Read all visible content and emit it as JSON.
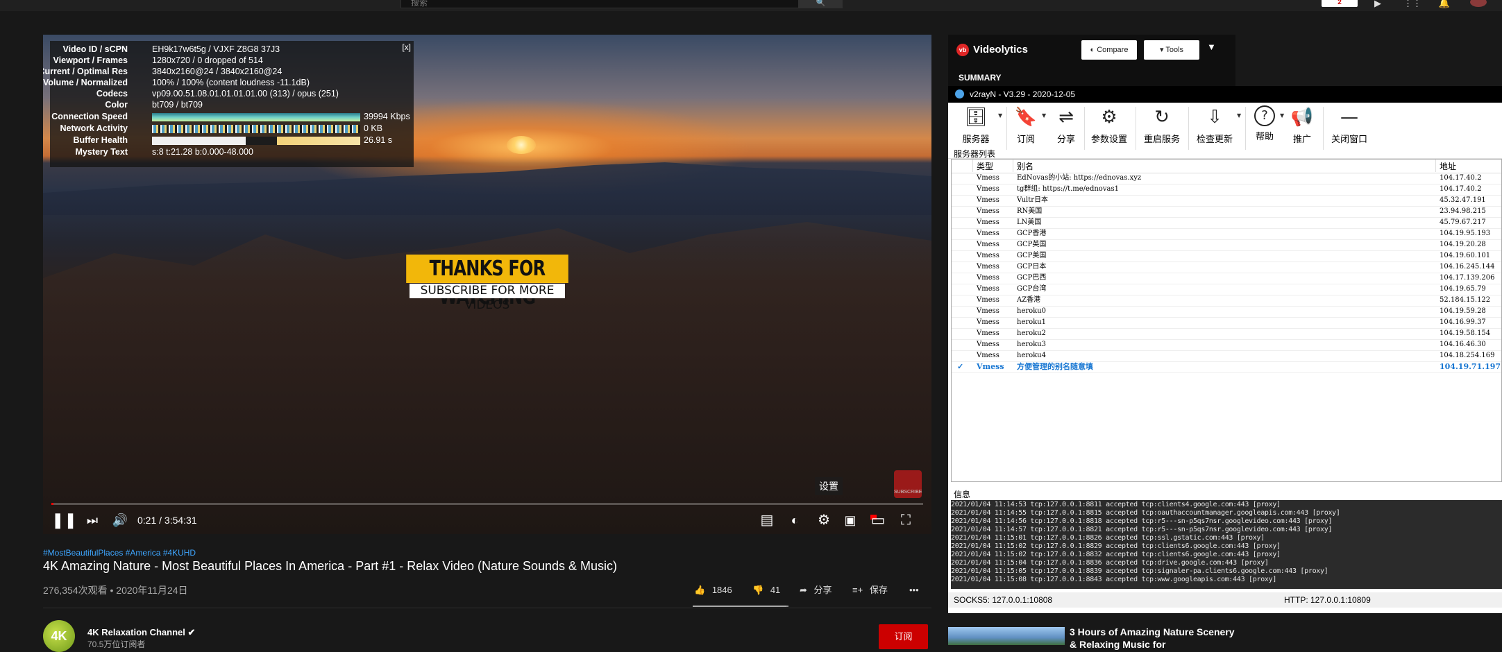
{
  "youtube": {
    "search_placeholder": "搜索",
    "search_icon_glyph": "🔍",
    "topbar_badge": "2",
    "topbar_icons": [
      "video-camera",
      "apps-grid",
      "bell"
    ]
  },
  "player": {
    "stats": [
      {
        "label": "Video ID / sCPN",
        "value": "EH9k17w6t5g / VJXF Z8G8 37J3"
      },
      {
        "label": "Viewport / Frames",
        "value": "1280x720 / 0 dropped of 514"
      },
      {
        "label": "Current / Optimal Res",
        "value": "3840x2160@24 / 3840x2160@24"
      },
      {
        "label": "Volume / Normalized",
        "value": "100% / 100% (content loudness -11.1dB)"
      },
      {
        "label": "Codecs",
        "value": "vp09.00.51.08.01.01.01.01.00 (313) / opus (251)"
      },
      {
        "label": "Color",
        "value": "bt709 / bt709"
      },
      {
        "label": "Connection Speed",
        "value": "39994 Kbps"
      },
      {
        "label": "Network Activity",
        "value": "0 KB"
      },
      {
        "label": "Buffer Health",
        "value": "26.91 s"
      },
      {
        "label": "Mystery Text",
        "value": "s:8 t:21.28 b:0.000-48.000"
      }
    ],
    "stats_close": "[x]",
    "overlay_title": "THANKS FOR WATCHING",
    "overlay_subtitle": "SUBSCRIBE FOR MORE VIDEOS",
    "time_display": "0:21 / 3:54:31",
    "progress_fraction": 0.0015,
    "settings_tooltip": "设置",
    "watermark_text": "SUBSCRIBE",
    "controls": {
      "play_pause": "❚❚",
      "next": "⏭",
      "volume": "🔊",
      "subtitles": "▤",
      "autoplay": "◐",
      "settings": "⚙",
      "miniplayer": "▣",
      "theater": "▭",
      "fullscreen": "⛶"
    }
  },
  "video": {
    "hashtags": "#MostBeautifulPlaces #America #4KUHD",
    "title": "4K Amazing Nature - Most Beautiful Places In America - Part #1 - Relax Video (Nature Sounds & Music)",
    "views": "276,354次观看 • 2020年11月24日",
    "likes": "1846",
    "dislikes": "41",
    "like_ratio": 0.978,
    "share": "分享",
    "save": "保存",
    "more": "•••",
    "like_icon": "👍",
    "dislike_icon": "👎",
    "share_icon": "➦",
    "save_icon": "≡+"
  },
  "channel": {
    "avatar_text": "4K",
    "name": "4K Relaxation Channel ✔",
    "subscribers": "70.5万位订阅者",
    "subscribe_button": "订阅"
  },
  "videolytics": {
    "logo": "vb",
    "title": "Videolytics",
    "compare": "◐ Compare",
    "tools": "▾ Tools",
    "caret": "▼",
    "summary": "SUMMARY"
  },
  "v2rayn": {
    "title": "v2rayN - V3.29 - 2020-12-05",
    "toolbar": [
      {
        "label": "服务器",
        "icon": "database-icon",
        "glyph": "🗄"
      },
      {
        "label": "订阅",
        "icon": "bookmark-icon",
        "glyph": "🔖"
      },
      {
        "label": "分享",
        "icon": "share-icon",
        "glyph": "⇌"
      },
      {
        "label": "参数设置",
        "icon": "gear-icon",
        "glyph": "⚙"
      },
      {
        "label": "重启服务",
        "icon": "refresh-icon",
        "glyph": "↻"
      },
      {
        "label": "检查更新",
        "icon": "download-icon",
        "glyph": "⇩"
      },
      {
        "label": "帮助",
        "icon": "help-icon",
        "glyph": "?"
      },
      {
        "label": "推广",
        "icon": "megaphone-icon",
        "glyph": "📢"
      },
      {
        "label": "关闭窗口",
        "icon": "minimize-icon",
        "glyph": "—"
      }
    ],
    "server_list_label": "服务器列表",
    "columns": {
      "type": "类型",
      "alias": "别名",
      "address": "地址"
    },
    "servers": [
      {
        "type": "Vmess",
        "alias": "EdNovas的小站: https://ednovas.xyz",
        "address": "104.17.40.2"
      },
      {
        "type": "Vmess",
        "alias": "tg群组: https://t.me/ednovas1",
        "address": "104.17.40.2"
      },
      {
        "type": "Vmess",
        "alias": "Vultr日本",
        "address": "45.32.47.191"
      },
      {
        "type": "Vmess",
        "alias": "RN美国",
        "address": "23.94.98.215"
      },
      {
        "type": "Vmess",
        "alias": "LN美国",
        "address": "45.79.67.217"
      },
      {
        "type": "Vmess",
        "alias": "GCP香港",
        "address": "104.19.95.193"
      },
      {
        "type": "Vmess",
        "alias": "GCP英国",
        "address": "104.19.20.28"
      },
      {
        "type": "Vmess",
        "alias": "GCP美国",
        "address": "104.19.60.101"
      },
      {
        "type": "Vmess",
        "alias": "GCP日本",
        "address": "104.16.245.144"
      },
      {
        "type": "Vmess",
        "alias": "GCP巴西",
        "address": "104.17.139.206"
      },
      {
        "type": "Vmess",
        "alias": "GCP台湾",
        "address": "104.19.65.79"
      },
      {
        "type": "Vmess",
        "alias": "AZ香港",
        "address": "52.184.15.122"
      },
      {
        "type": "Vmess",
        "alias": "heroku0",
        "address": "104.19.59.28"
      },
      {
        "type": "Vmess",
        "alias": "heroku1",
        "address": "104.16.99.37"
      },
      {
        "type": "Vmess",
        "alias": "heroku2",
        "address": "104.19.58.154"
      },
      {
        "type": "Vmess",
        "alias": "heroku3",
        "address": "104.16.46.30"
      },
      {
        "type": "Vmess",
        "alias": "heroku4",
        "address": "104.18.254.169"
      },
      {
        "type": "Vmess",
        "alias": "方便管理的别名随意填",
        "address": "104.19.71.197",
        "selected": true,
        "check": "✓"
      }
    ],
    "info_label": "信息",
    "log": [
      "2021/01/04 11:14:53 tcp:127.0.0.1:8811 accepted tcp:clients4.google.com:443 [proxy]",
      "2021/01/04 11:14:55 tcp:127.0.0.1:8815 accepted tcp:oauthaccountmanager.googleapis.com:443 [proxy]",
      "2021/01/04 11:14:56 tcp:127.0.0.1:8818 accepted tcp:r5---sn-p5qs7nsr.googlevideo.com:443 [proxy]",
      "2021/01/04 11:14:57 tcp:127.0.0.1:8821 accepted tcp:r5---sn-p5qs7nsr.googlevideo.com:443 [proxy]",
      "2021/01/04 11:15:01 tcp:127.0.0.1:8826 accepted tcp:ssl.gstatic.com:443 [proxy]",
      "2021/01/04 11:15:02 tcp:127.0.0.1:8829 accepted tcp:clients6.google.com:443 [proxy]",
      "2021/01/04 11:15:02 tcp:127.0.0.1:8832 accepted tcp:clients6.google.com:443 [proxy]",
      "2021/01/04 11:15:04 tcp:127.0.0.1:8836 accepted tcp:drive.google.com:443 [proxy]",
      "2021/01/04 11:15:05 tcp:127.0.0.1:8839 accepted tcp:signaler-pa.clients6.google.com:443 [proxy]",
      "2021/01/04 11:15:08 tcp:127.0.0.1:8843 accepted tcp:www.googleapis.com:443 [proxy]"
    ],
    "status_socks": "SOCKS5:  127.0.0.1:10808",
    "status_http": "HTTP:  127.0.0.1:10809"
  },
  "recommended": {
    "title": "3 Hours of Amazing Nature Scenery & Relaxing Music for"
  }
}
